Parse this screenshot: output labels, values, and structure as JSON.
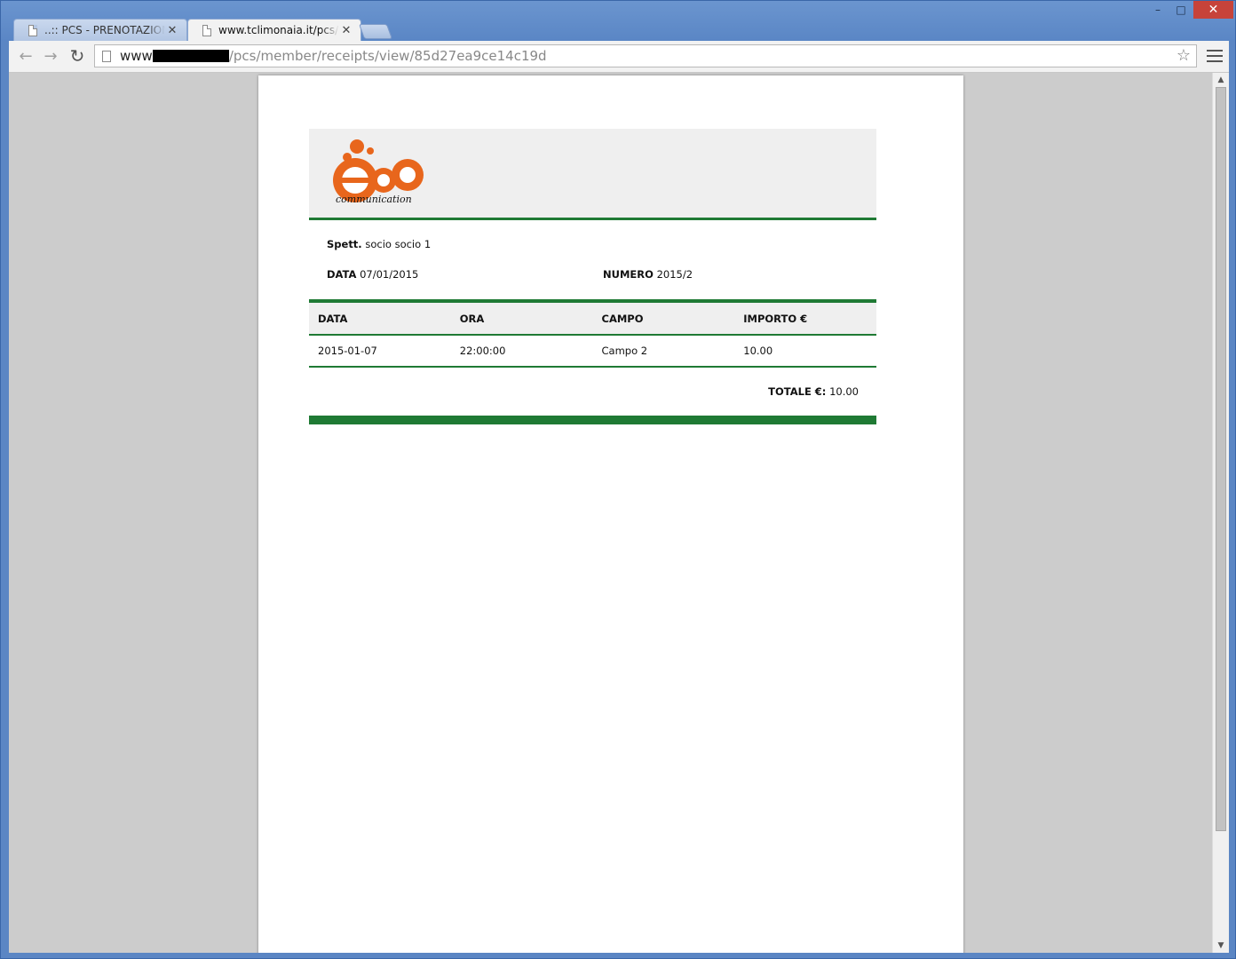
{
  "browser": {
    "tabs": [
      {
        "title": "..:: PCS - PRENOTAZIONE",
        "active": false
      },
      {
        "title": "www.tclimonaia.it/pcs/m",
        "active": true
      }
    ],
    "window_controls": {
      "minimize": "–",
      "maximize": "□",
      "close": "✕"
    },
    "address": {
      "prefix": "www",
      "path": "/pcs/member/receipts/view/85d27ea9ce14c19d"
    },
    "accent": "#5b86c4"
  },
  "receipt": {
    "logo_text": "eGO",
    "logo_sub": "communication",
    "recipient_label": "Spett.",
    "recipient_value": "socio socio 1",
    "date_label": "DATA",
    "date_value": "07/01/2015",
    "number_label": "NUMERO",
    "number_value": "2015/2",
    "columns": [
      "DATA",
      "ORA",
      "CAMPO",
      "IMPORTO €"
    ],
    "rows": [
      [
        "2015-01-07",
        "22:00:00",
        "Campo 2",
        "10.00"
      ]
    ],
    "total_label": "TOTALE €:",
    "total_value": "10.00",
    "accent_color": "#1f7a34",
    "logo_color": "#e8661c"
  }
}
